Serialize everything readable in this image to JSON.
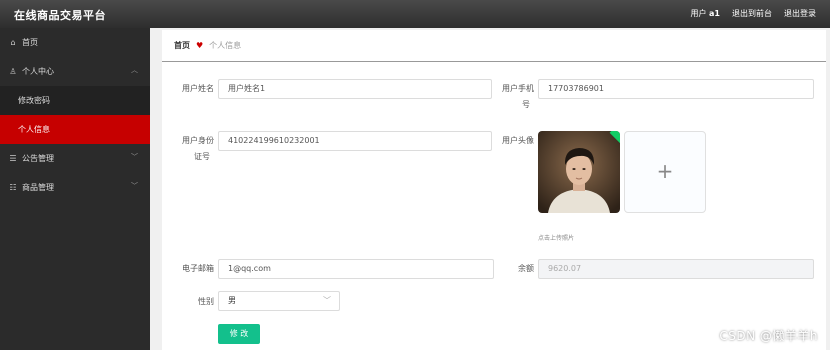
{
  "header": {
    "app_title": "在线商品交易平台",
    "user_prefix": "用户",
    "username": "a1",
    "back_front": "退出到前台",
    "logout": "退出登录"
  },
  "sidebar": {
    "items": [
      {
        "label": "首页",
        "icon": "home-icon"
      },
      {
        "label": "个人中心",
        "icon": "user-icon"
      },
      {
        "label": "修改密码"
      },
      {
        "label": "个人信息"
      },
      {
        "label": "公告管理",
        "icon": "list-icon"
      },
      {
        "label": "商品管理",
        "icon": "sliders-icon"
      }
    ]
  },
  "breadcrumb": {
    "home": "首页",
    "current": "个人信息"
  },
  "form": {
    "name_label": "用户姓名",
    "name_value": "用户姓名1",
    "phone_label_1": "用户手机",
    "phone_label_2": "号",
    "phone_value": "17703786901",
    "idcard_label_1": "用户身份",
    "idcard_label_2": "证号",
    "idcard_value": "410224199610232001",
    "avatar_label": "用户头像",
    "upload_hint": "点击上传照片",
    "email_label": "电子邮箱",
    "email_value": "1@qq.com",
    "balance_label": "余额",
    "balance_value": "9620.07",
    "gender_label": "性别",
    "gender_value": "男",
    "submit": "修 改"
  },
  "watermark": "CSDN @懒羊羊h",
  "colors": {
    "accent": "#c60000",
    "button": "#13c08c",
    "sidebar": "#2b2b2b"
  }
}
